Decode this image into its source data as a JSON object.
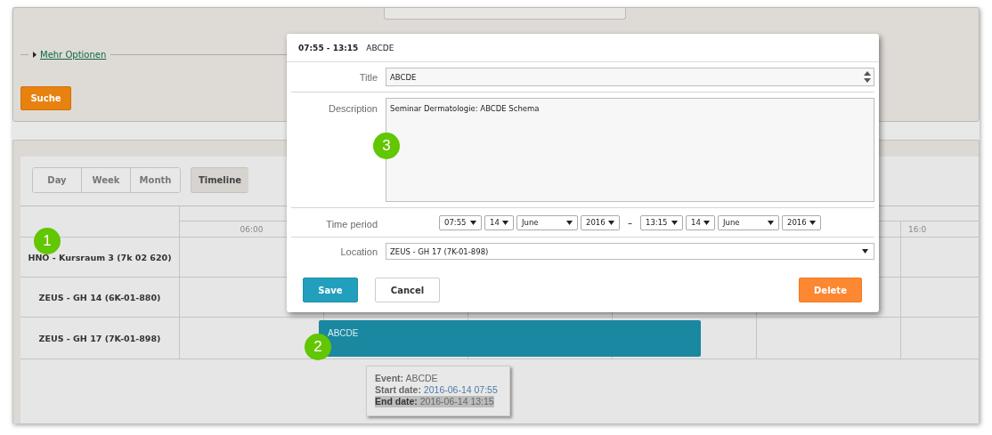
{
  "search_panel": {
    "more_options_link": "Mehr Optionen",
    "search_button": "Suche"
  },
  "view_buttons": [
    {
      "label": "Day",
      "selected": false
    },
    {
      "label": "Week",
      "selected": false
    },
    {
      "label": "Month",
      "selected": false
    },
    {
      "label": "Timeline",
      "selected": true
    }
  ],
  "timeline": {
    "time_labels": [
      "06:00",
      "16:0"
    ],
    "rooms": [
      "HNO - Kursraum 3 (7k 02 620)",
      "ZEUS - GH 14 (6K-01-880)",
      "ZEUS - GH 17 (7K-01-898)"
    ],
    "event": {
      "label": "ABCDE"
    }
  },
  "tooltip": {
    "lines": [
      {
        "label": "Event:",
        "value": "ABCDE",
        "highlighted": false
      },
      {
        "label": "Start date:",
        "value": "2016-06-14 07:55",
        "highlighted": false
      },
      {
        "label": "End date:",
        "value": "2016-06-14 13:15",
        "highlighted": true
      }
    ]
  },
  "dialog": {
    "header_time": "07:55 - 13:15",
    "header_title": "ABCDE",
    "title": {
      "label": "Title",
      "value": "ABCDE"
    },
    "description": {
      "label": "Description",
      "value": "Seminar Dermatologie: ABCDE Schema"
    },
    "time_period": {
      "label": "Time period",
      "start": [
        "07:55",
        "14",
        "June",
        "2016"
      ],
      "separator": "–",
      "end": [
        "13:15",
        "14",
        "June",
        "2016"
      ]
    },
    "location": {
      "label": "Location",
      "value": "ZEUS - GH 17 (7K-01-898)"
    },
    "buttons": [
      {
        "label": "Save",
        "kind": "primary"
      },
      {
        "label": "Cancel",
        "kind": "secondary"
      },
      {
        "label": "Delete",
        "kind": "danger"
      }
    ]
  },
  "callouts": [
    "1",
    "2",
    "3"
  ]
}
